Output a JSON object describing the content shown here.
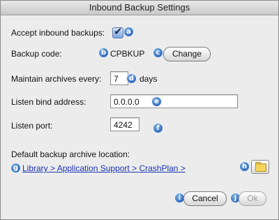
{
  "window": {
    "title": "Inbound Backup Settings"
  },
  "accept": {
    "label": "Accept inbound backups:",
    "checked": true,
    "badge": "a"
  },
  "backup_code": {
    "label": "Backup code:",
    "value": "CPBKUP",
    "badge_value": "b",
    "change_label": "Change",
    "badge_change": "c"
  },
  "maintain": {
    "label": "Maintain archives every:",
    "value": "7",
    "badge": "d",
    "unit": "days"
  },
  "bind_address": {
    "label": "Listen bind address:",
    "value": "0.0.0.0",
    "badge": "e"
  },
  "listen_port": {
    "label": "Listen port:",
    "value": "4242",
    "badge": "f"
  },
  "archive_location": {
    "label": "Default backup archive location:",
    "path": "Library > Application Support > CrashPlan >",
    "badge_path": "g",
    "badge_folder": "h",
    "folder_icon": "folder-icon"
  },
  "footer": {
    "cancel_label": "Cancel",
    "ok_label": "Ok",
    "badge_cancel": "i",
    "badge_ok": "j"
  }
}
